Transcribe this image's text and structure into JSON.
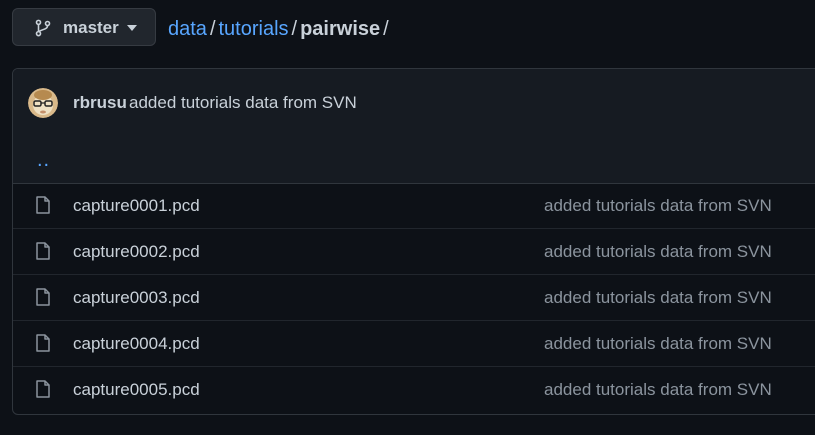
{
  "branch": {
    "label": "master",
    "icon": "git-branch-icon"
  },
  "breadcrumb": {
    "root": "data",
    "middle": "tutorials",
    "current": "pairwise",
    "separator": "/"
  },
  "commit": {
    "author": "rbrusu",
    "message": "added tutorials data from SVN"
  },
  "parent_link": "..",
  "files": [
    {
      "name": "capture0001.pcd",
      "commit": "added tutorials data from SVN"
    },
    {
      "name": "capture0002.pcd",
      "commit": "added tutorials data from SVN"
    },
    {
      "name": "capture0003.pcd",
      "commit": "added tutorials data from SVN"
    },
    {
      "name": "capture0004.pcd",
      "commit": "added tutorials data from SVN"
    },
    {
      "name": "capture0005.pcd",
      "commit": "added tutorials data from SVN"
    }
  ],
  "colors": {
    "background": "#0d1117",
    "link": "#58a6ff",
    "text": "#c9d1d9",
    "muted": "#8b949e",
    "border": "#30363d"
  }
}
